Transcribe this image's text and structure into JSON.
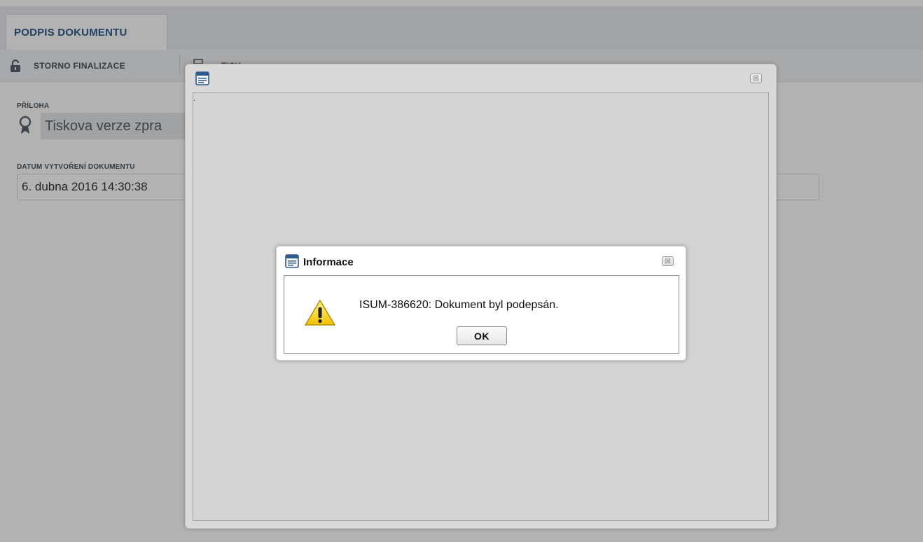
{
  "tab": {
    "label": "PODPIS DOKUMENTU"
  },
  "toolbar": {
    "storno_label": "STORNO FINALIZACE",
    "print_label": "TISK"
  },
  "fields": {
    "attachment_label": "PŘÍLOHA",
    "attachment_value": "Tiskova verze zpra",
    "date_label": "DATUM VYTVOŘENÍ DOKUMENTU",
    "date_value": "6. dubna 2016 14:30:38"
  },
  "print_window": {
    "icon": "window-icon",
    "close": "close-icon",
    "content_mark": "."
  },
  "dialog": {
    "title": "Informace",
    "message": "ISUM-386620: Dokument byl podepsán.",
    "ok_label": "OK",
    "icon": "warning-icon",
    "close_glyph": "☒"
  }
}
